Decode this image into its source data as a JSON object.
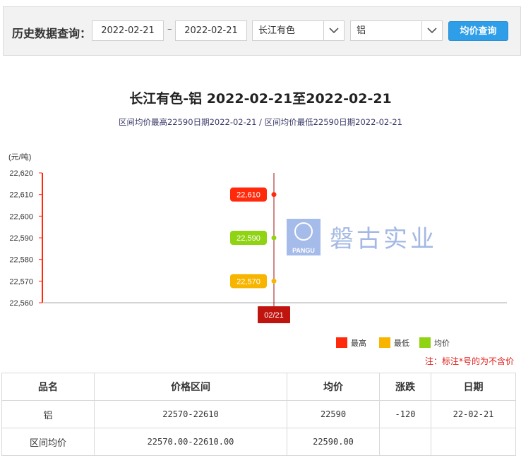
{
  "query": {
    "label": "历史数据查询：",
    "date_from": "2022-02-21",
    "date_to": "2022-02-21",
    "separator": "–",
    "market": "长江有色",
    "product": "铝",
    "button": "均价查询"
  },
  "chart_title": "长江有色-铝 2022-02-21至2022-02-21",
  "chart_subtitle": "区间均价最高22590日期2022-02-21 / 区间均价最低22590日期2022-02-21",
  "watermark": "磐古实业",
  "watermark_logo_text": "PANGU",
  "note": "注：标注*号的为不含价",
  "chart_data": {
    "type": "line",
    "unit_label": "(元/吨)",
    "ylim": [
      22560,
      22620
    ],
    "y_ticks": [
      22560,
      22570,
      22580,
      22590,
      22600,
      22610,
      22620
    ],
    "x": [
      "02/21"
    ],
    "series": [
      {
        "name": "最高",
        "values": [
          22610
        ],
        "color": "#ff2a0c",
        "label": "22,610"
      },
      {
        "name": "最低",
        "values": [
          22570
        ],
        "color": "#f7b500",
        "label": "22,570"
      },
      {
        "name": "均价",
        "values": [
          22590
        ],
        "color": "#8fd312",
        "label": "22,590"
      }
    ],
    "legend_position": "bottom-right"
  },
  "table": {
    "headers": [
      "品名",
      "价格区间",
      "均价",
      "涨跌",
      "日期"
    ],
    "rows": [
      [
        "铝",
        "22570-22610",
        "22590",
        "-120",
        "22-02-21"
      ],
      [
        "区间均价",
        "22570.00-22610.00",
        "22590.00",
        "",
        ""
      ]
    ]
  }
}
